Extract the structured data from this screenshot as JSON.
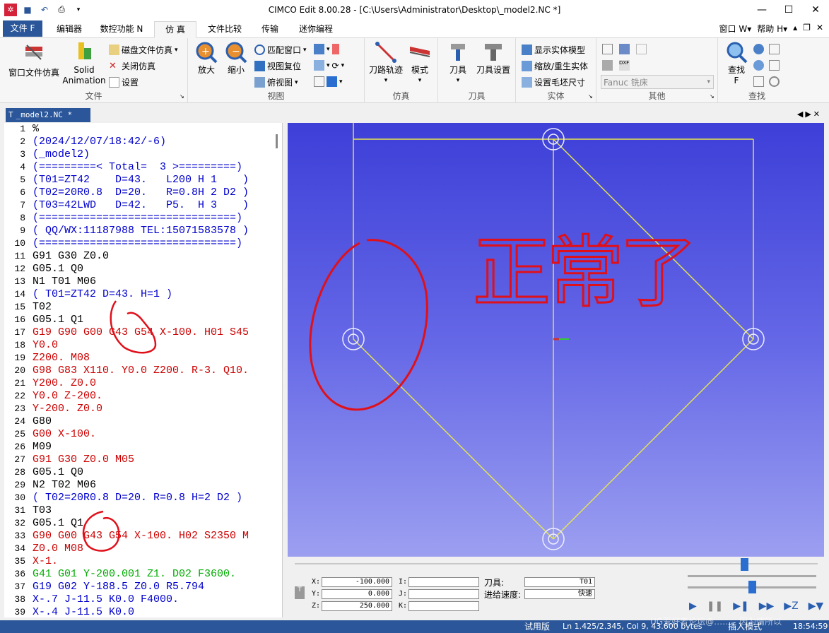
{
  "window": {
    "title": "CIMCO Edit 8.00.28 - [C:\\Users\\Administrator\\Desktop\\_model2.NC *]"
  },
  "menu_tabs": [
    {
      "label": "文件 F"
    },
    {
      "label": "编辑器"
    },
    {
      "label": "数控功能 N"
    },
    {
      "label": "仿 真"
    },
    {
      "label": "文件比较"
    },
    {
      "label": "传输"
    },
    {
      "label": "迷你编程"
    }
  ],
  "right_menu": {
    "window": "窗口 W",
    "help": "帮助 H"
  },
  "ribbon": {
    "file_group": {
      "label": "文件",
      "window_sim": "窗口文件仿真",
      "solid_anim": "Solid\nAnimation",
      "disk_sim": "磁盘文件仿真",
      "close_sim": "关闭仿真",
      "settings": "设置"
    },
    "view_group": {
      "label": "视图",
      "zoom_in": "放大",
      "zoom_out": "缩小",
      "fit_window": "匹配窗口",
      "reset_view": "视图复位",
      "top_view": "俯视图"
    },
    "sim_group": {
      "label": "仿真",
      "toolpath": "刀路轨迹",
      "mode": "模式"
    },
    "tool_group": {
      "label": "刀具",
      "tool": "刀具",
      "tool_settings": "刀具设置"
    },
    "solid_group": {
      "label": "实体",
      "show_solid": "显示实体模型",
      "zoom_regen": "缩放/重生实体",
      "stock_size": "设置毛坯尺寸"
    },
    "other_group": {
      "label": "其他",
      "machine": "Fanuc 铣床"
    },
    "find_group": {
      "label": "查找",
      "find": "查找",
      "find_key": "F"
    }
  },
  "document_tab": {
    "name": "_model2.NC *"
  },
  "code_lines": [
    {
      "n": "1",
      "text": "%",
      "color": "#000000"
    },
    {
      "n": "2",
      "text": "(2024/12/07/18:42/-6)",
      "color": "#0000cc"
    },
    {
      "n": "3",
      "text": "(_model2)",
      "color": "#0000cc"
    },
    {
      "n": "4",
      "text": "(=========< Total=  3 >=========)",
      "color": "#0000cc"
    },
    {
      "n": "5",
      "text": "(T01=ZT42    D=43.   L200 H 1    )",
      "color": "#0000cc"
    },
    {
      "n": "6",
      "text": "(T02=20R0.8  D=20.   R=0.8H 2 D2 )",
      "color": "#0000cc"
    },
    {
      "n": "7",
      "text": "(T03=42LWD   D=42.   P5.  H 3    )",
      "color": "#0000cc"
    },
    {
      "n": "8",
      "text": "(===============================)",
      "color": "#0000cc"
    },
    {
      "n": "9",
      "text": "( QQ/WX:11187988 TEL:15071583578 )",
      "color": "#0000cc"
    },
    {
      "n": "10",
      "text": "(===============================)",
      "color": "#0000cc"
    },
    {
      "n": "11",
      "text": "G91 G30 Z0.0",
      "color": "#000000"
    },
    {
      "n": "12",
      "text": "G05.1 Q0",
      "color": "#000000"
    },
    {
      "n": "13",
      "text": "N1 T01 M06",
      "color": "#000000"
    },
    {
      "n": "14",
      "text": "( T01=ZT42 D=43. H=1 )",
      "color": "#0000cc"
    },
    {
      "n": "15",
      "text": "T02",
      "color": "#000000"
    },
    {
      "n": "16",
      "text": "G05.1 Q1",
      "color": "#000000"
    },
    {
      "n": "17",
      "text": "G19 G90 G00 G43 G54 X-100. H01 S45",
      "color": "#cc0000"
    },
    {
      "n": "18",
      "text": "Y0.0",
      "color": "#cc0000"
    },
    {
      "n": "19",
      "text": "Z200. M08",
      "color": "#cc0000"
    },
    {
      "n": "20",
      "text": "G98 G83 X110. Y0.0 Z200. R-3. Q10.",
      "color": "#cc0000"
    },
    {
      "n": "21",
      "text": "Y200. Z0.0",
      "color": "#cc0000"
    },
    {
      "n": "22",
      "text": "Y0.0 Z-200.",
      "color": "#cc0000"
    },
    {
      "n": "23",
      "text": "Y-200. Z0.0",
      "color": "#cc0000"
    },
    {
      "n": "24",
      "text": "G80",
      "color": "#000000"
    },
    {
      "n": "25",
      "text": "G00 X-100.",
      "color": "#cc0000"
    },
    {
      "n": "26",
      "text": "M09",
      "color": "#000000"
    },
    {
      "n": "27",
      "text": "G91 G30 Z0.0 M05",
      "color": "#cc0000"
    },
    {
      "n": "28",
      "text": "G05.1 Q0",
      "color": "#000000"
    },
    {
      "n": "29",
      "text": "N2 T02 M06",
      "color": "#000000"
    },
    {
      "n": "30",
      "text": "( T02=20R0.8 D=20. R=0.8 H=2 D2 )",
      "color": "#0000cc"
    },
    {
      "n": "31",
      "text": "T03",
      "color": "#000000"
    },
    {
      "n": "32",
      "text": "G05.1 Q1",
      "color": "#000000"
    },
    {
      "n": "33",
      "text": "G90 G00 G43 G54 X-100. H02 S2350 M",
      "color": "#cc0000"
    },
    {
      "n": "34",
      "text": "Z0.0 M08",
      "color": "#cc0000"
    },
    {
      "n": "35",
      "text": "X-1.",
      "color": "#cc0000"
    },
    {
      "n": "36",
      "text": "G41 G01 Y-200.001 Z1. D02 F3600.",
      "color": "#00aa00"
    },
    {
      "n": "37",
      "text": "G19 G02 Y-188.5 Z0.0 R5.794",
      "color": "#0000cc"
    },
    {
      "n": "38",
      "text": "X-.7 J-11.5 K0.0 F4000.",
      "color": "#0000cc"
    },
    {
      "n": "39",
      "text": "X-.4 J-11.5 K0.0",
      "color": "#0000cc"
    }
  ],
  "annotation": {
    "handwriting": "正常了",
    "color": "#e0101a"
  },
  "readout": {
    "x_label": "X:",
    "x": "-100.000",
    "y_label": "Y:",
    "y": "0.000",
    "z_label": "Z:",
    "z": "250.000",
    "i_label": "I:",
    "j_label": "J:",
    "k_label": "K:",
    "tool_label": "刀具:",
    "tool": "T01",
    "feed_label": "进给速度:",
    "feed": "快速"
  },
  "status": {
    "trial": "试用版",
    "position": "Ln 1.425/2.345, Col 9, 43.600 bytes",
    "mode": "插入模式",
    "time": "18:54:59",
    "watermark": "UG爱好者论坛@……、因为情所以"
  }
}
